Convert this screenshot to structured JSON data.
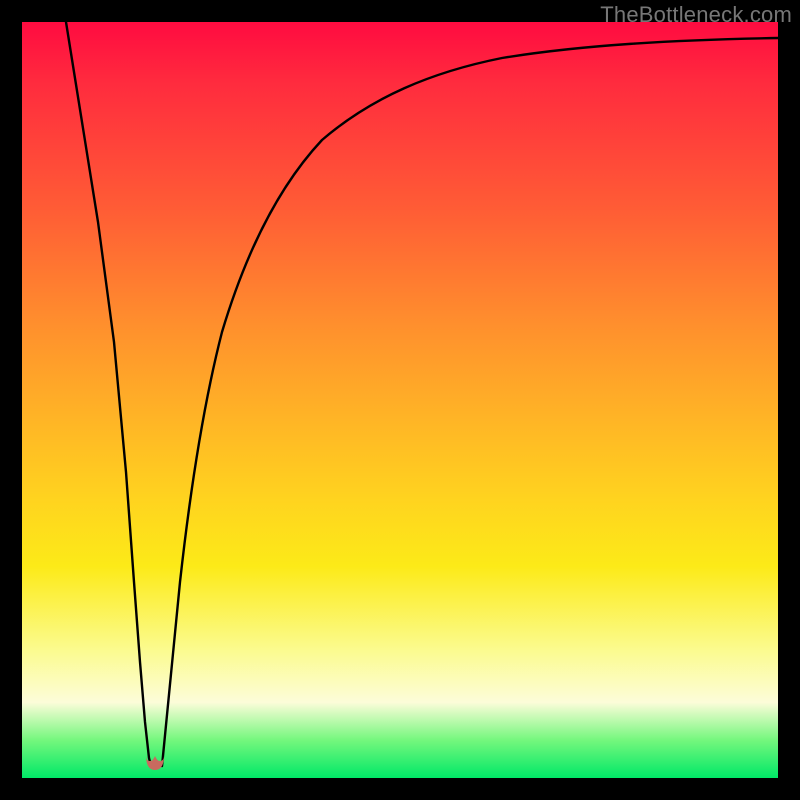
{
  "watermark": {
    "text": "TheBottleneck.com"
  },
  "chart_data": {
    "type": "line",
    "title": "",
    "xlabel": "",
    "ylabel": "",
    "x_range": [
      0,
      100
    ],
    "y_range": [
      0,
      100
    ],
    "grid": false,
    "legend": false,
    "notes": "Background is a vertical gradient from red (top / high bottleneck) through orange and yellow to green (bottom / optimal). Single black curve shows bottleneck percentage as a function of a hardware/performance variable along the x-axis. The curve plunges from ~100 at x≈5 to ~0 at the optimum near x≈17, then rises toward ~95 as x→100. A small rounded marker sits at the minimum.",
    "series": [
      {
        "name": "bottleneck",
        "x": [
          5,
          7,
          9,
          11,
          13,
          14.5,
          15.5,
          16.5,
          17.5,
          18.5,
          19.5,
          21,
          23,
          26,
          30,
          35,
          40,
          46,
          53,
          61,
          70,
          80,
          90,
          100
        ],
        "y": [
          100,
          84,
          68,
          52,
          34,
          20,
          10,
          3,
          1,
          3,
          9,
          20,
          33,
          46,
          57,
          66,
          73,
          79,
          84,
          88,
          91,
          93,
          94.5,
          95
        ]
      }
    ],
    "optimum_marker": {
      "x": 17,
      "y": 1
    },
    "gradient_stops": [
      {
        "pos": 0.0,
        "color": "#ff0b40"
      },
      {
        "pos": 0.4,
        "color": "#ff8f2d"
      },
      {
        "pos": 0.72,
        "color": "#fcea18"
      },
      {
        "pos": 0.9,
        "color": "#fcfcd9"
      },
      {
        "pos": 1.0,
        "color": "#00e867"
      }
    ]
  }
}
